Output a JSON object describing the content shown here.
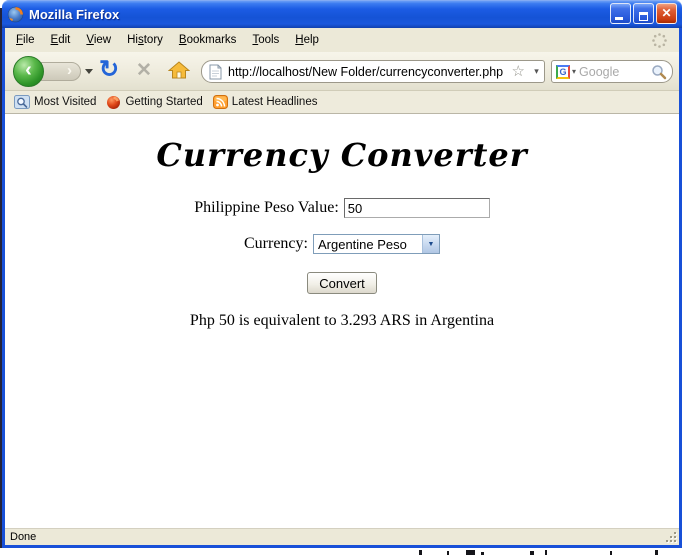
{
  "window": {
    "title": "Mozilla Firefox"
  },
  "menu": {
    "items": [
      {
        "pre": "",
        "key": "F",
        "post": "ile"
      },
      {
        "pre": "",
        "key": "E",
        "post": "dit"
      },
      {
        "pre": "",
        "key": "V",
        "post": "iew"
      },
      {
        "pre": "Hi",
        "key": "s",
        "post": "tory"
      },
      {
        "pre": "",
        "key": "B",
        "post": "ookmarks"
      },
      {
        "pre": "",
        "key": "T",
        "post": "ools"
      },
      {
        "pre": "",
        "key": "H",
        "post": "elp"
      }
    ]
  },
  "nav": {
    "url": "http://localhost/New Folder/currencyconverter.php",
    "search_placeholder": "Google"
  },
  "bookmarks": {
    "items": [
      {
        "label": "Most Visited",
        "icon": "most-visited-icon"
      },
      {
        "label": "Getting Started",
        "icon": "firefox-icon"
      },
      {
        "label": "Latest Headlines",
        "icon": "rss-icon"
      }
    ]
  },
  "page": {
    "title": "Currency Converter",
    "peso_label": "Philippine Peso Value:",
    "peso_value": "50",
    "currency_label": "Currency:",
    "currency_value": "Argentine Peso",
    "convert_label": "Convert",
    "result": "Php 50 is equivalent to 3.293 ARS in Argentina"
  },
  "status": {
    "text": "Done"
  },
  "icons": {
    "back": "‹",
    "forward": "›",
    "refresh": "↻",
    "stop": "✕",
    "star": "☆",
    "dropdown": "▾",
    "select_arrow": "▼",
    "close": "✕"
  },
  "colors": {
    "titlebar_blue": "#1c5ce4",
    "window_border_blue": "#1850d8",
    "toolbar_beige": "#ece9d8",
    "back_green": "#2e9428",
    "close_red": "#cc3d12",
    "select_border": "#7f9db9"
  }
}
